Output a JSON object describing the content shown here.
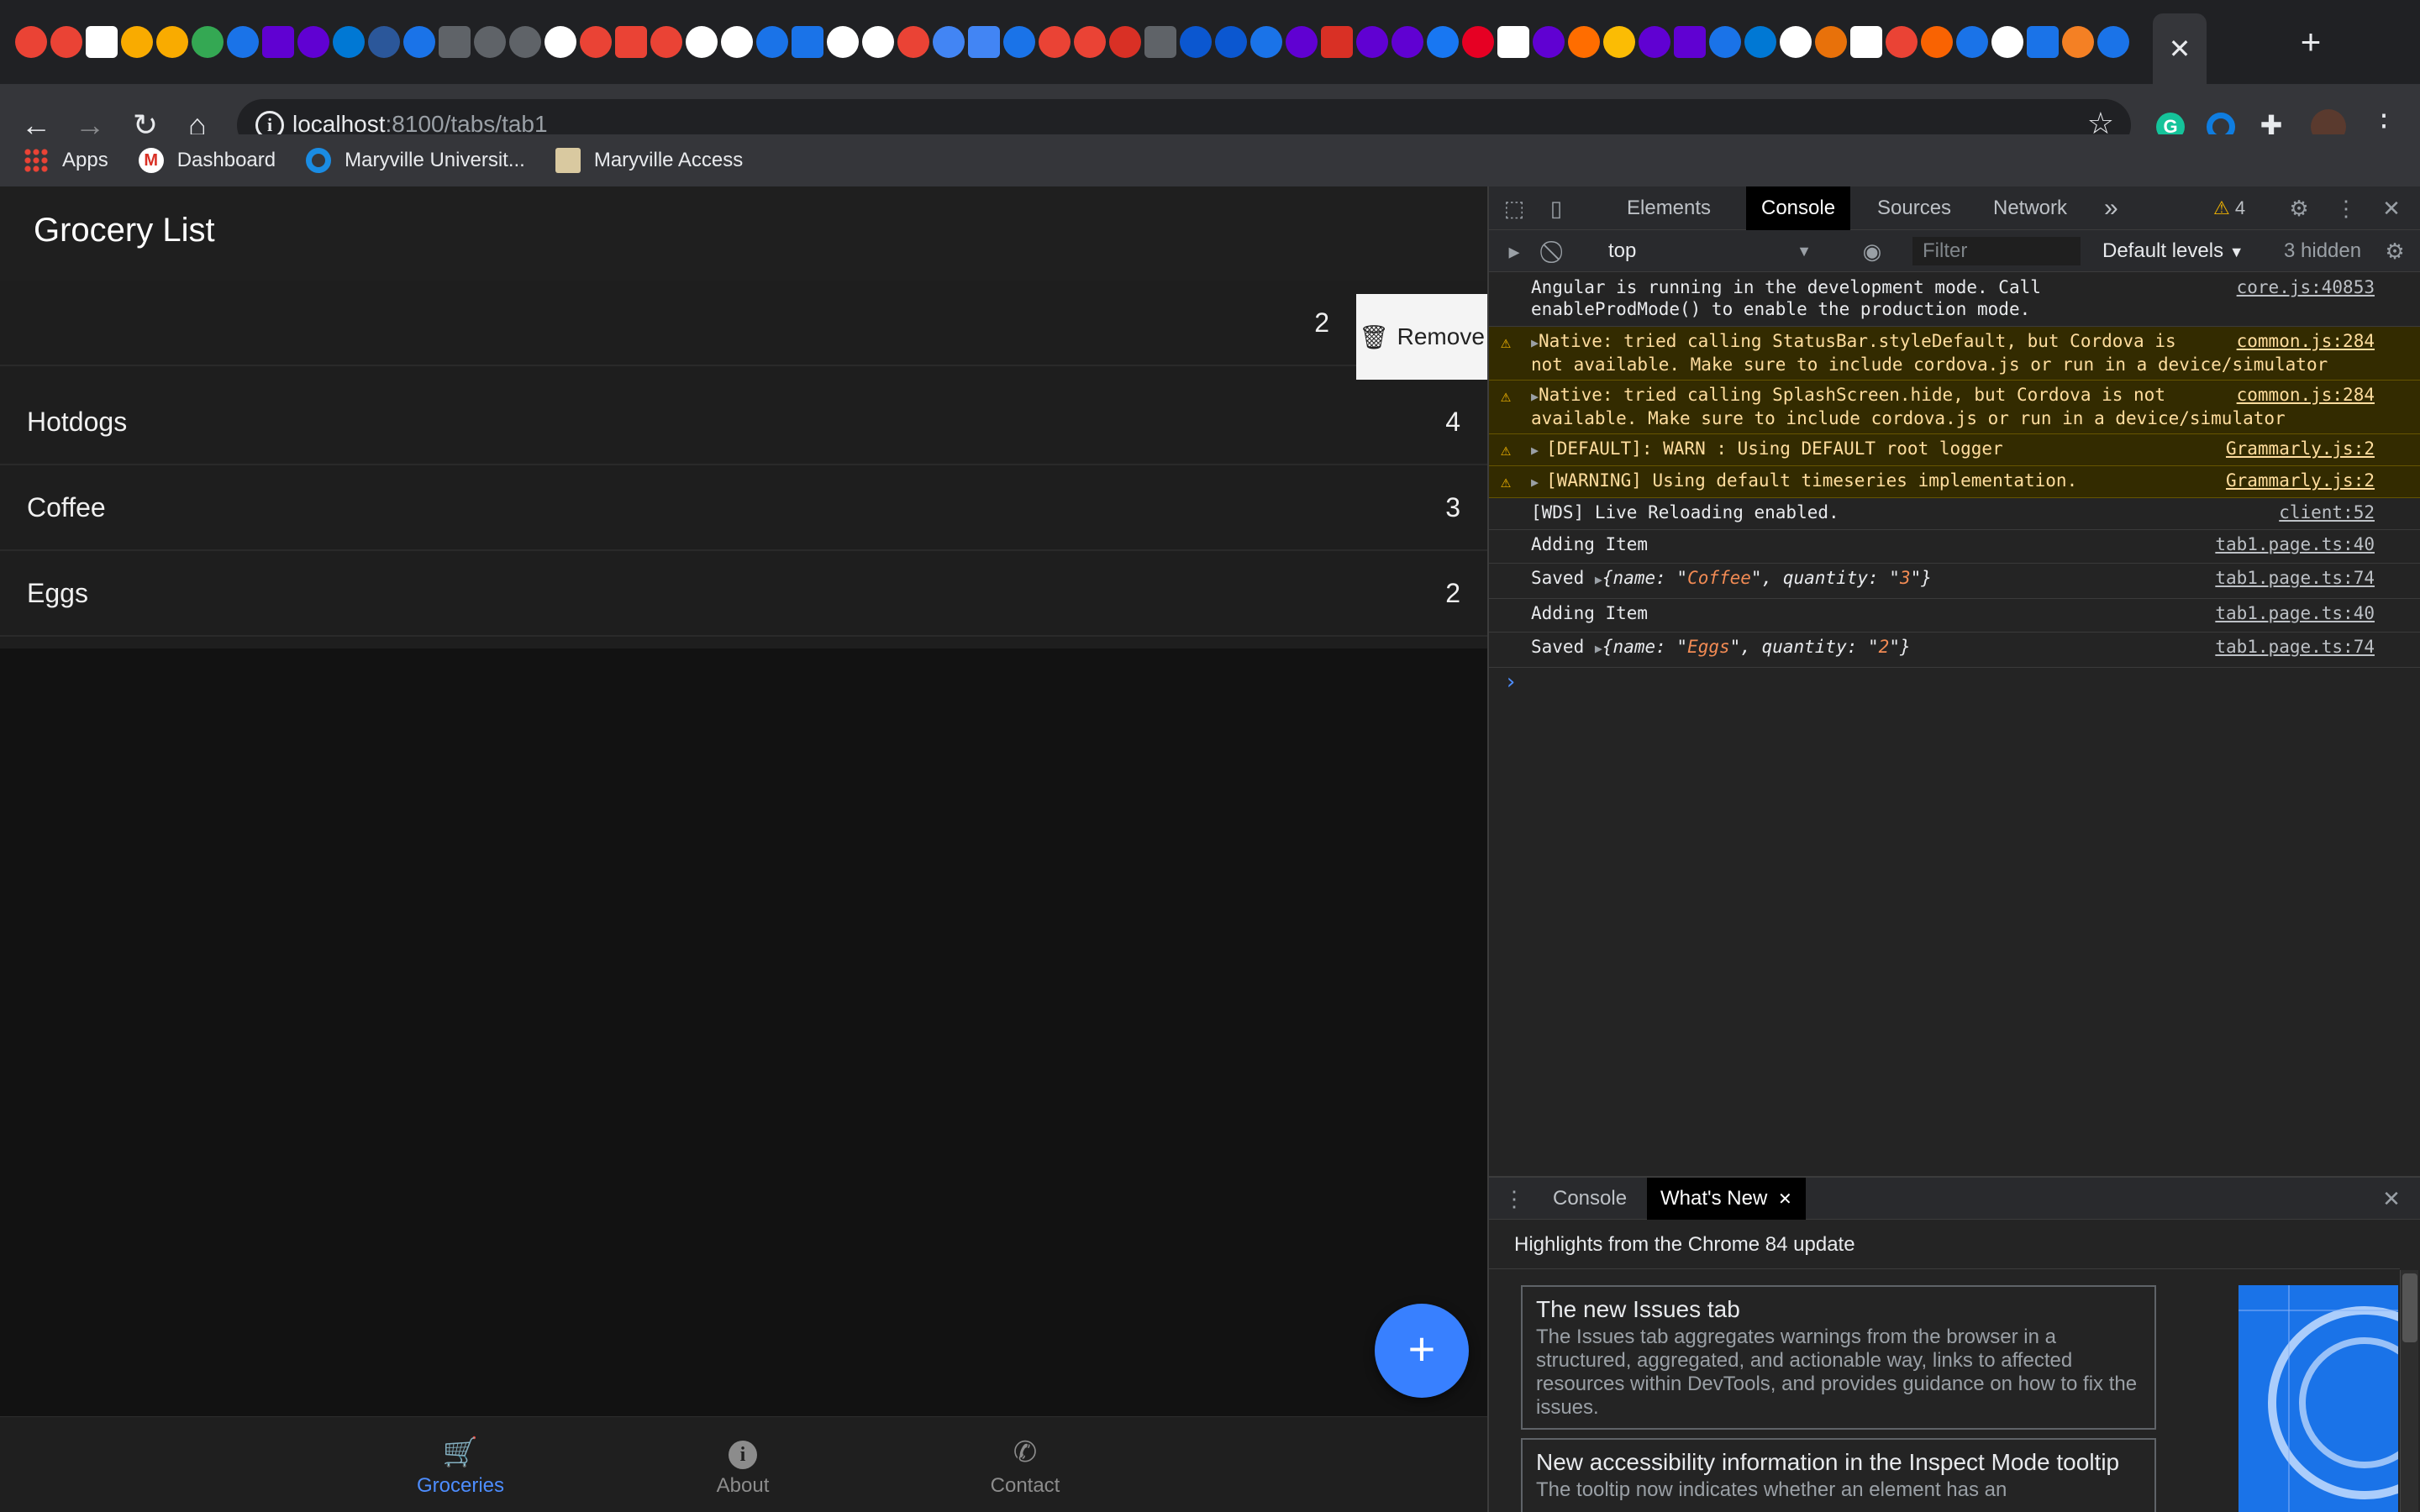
{
  "browser": {
    "url_host": "localhost",
    "url_path": ":8100/tabs/tab1",
    "bookmarks": [
      {
        "label": "Apps"
      },
      {
        "label": "Dashboard"
      },
      {
        "label": "Maryville Universit..."
      },
      {
        "label": "Maryville Access"
      }
    ]
  },
  "app": {
    "title": "Grocery List",
    "items": [
      {
        "name": "",
        "quantity": "2",
        "swiped": true
      },
      {
        "name": "Hotdogs",
        "quantity": "4"
      },
      {
        "name": "Coffee",
        "quantity": "3"
      },
      {
        "name": "Eggs",
        "quantity": "2"
      }
    ],
    "remove_label": "Remove",
    "fab_label": "+",
    "tabs": [
      {
        "label": "Groceries",
        "icon": "cart-icon",
        "active": true
      },
      {
        "label": "About",
        "icon": "info-icon"
      },
      {
        "label": "Contact",
        "icon": "phone-icon"
      }
    ],
    "accent_color": "#3880ff"
  },
  "devtools": {
    "tabs": [
      "Elements",
      "Console",
      "Sources",
      "Network"
    ],
    "active_tab": "Console",
    "more_tabs": "»",
    "warning_count": "4",
    "context": "top",
    "filter_placeholder": "Filter",
    "levels_label": "Default levels",
    "hidden_label": "3 hidden",
    "messages": [
      {
        "level": "info",
        "line1": "Angular is running in the development mode. Call",
        "line2": "enableProdMode() to enable the production mode.",
        "source": "core.js:40853"
      },
      {
        "level": "warn",
        "line1": "Native: tried calling StatusBar.styleDefault, but Cordova is",
        "line2": "not available. Make sure to include cordova.js or run in a device/simulator",
        "source": "common.js:284"
      },
      {
        "level": "warn",
        "line1": "Native: tried calling SplashScreen.hide, but Cordova is not",
        "line2": "available. Make sure to include cordova.js or run in a device/simulator",
        "source": "common.js:284"
      },
      {
        "level": "warn",
        "line1": "[DEFAULT]: WARN : Using DEFAULT root logger",
        "source": "Grammarly.js:2"
      },
      {
        "level": "warn",
        "line1": "[WARNING] Using default timeseries implementation.",
        "source": "Grammarly.js:2"
      },
      {
        "level": "info",
        "line1": "[WDS] Live Reloading enabled.",
        "source": "client:52"
      },
      {
        "level": "info",
        "line1": "Adding Item",
        "source": "tab1.page.ts:40"
      },
      {
        "level": "info",
        "line1": "Saved",
        "obj_name": "Coffee",
        "obj_qty": "3",
        "source": "tab1.page.ts:74"
      },
      {
        "level": "info",
        "line1": "Adding Item",
        "source": "tab1.page.ts:40"
      },
      {
        "level": "info",
        "line1": "Saved",
        "obj_name": "Eggs",
        "obj_qty": "2",
        "source": "tab1.page.ts:74"
      }
    ],
    "drawer": {
      "tabs": [
        "Console",
        "What's New"
      ],
      "active_tab": "What's New",
      "highlights": "Highlights from the Chrome 84 update",
      "cards": [
        {
          "title": "The new Issues tab",
          "body": "The Issues tab aggregates warnings from the browser in a structured, aggregated, and actionable way, links to affected resources within DevTools, and provides guidance on how to fix the issues."
        },
        {
          "title": "New accessibility information in the Inspect Mode tooltip",
          "body": "The tooltip now indicates whether an element has an"
        }
      ]
    }
  }
}
